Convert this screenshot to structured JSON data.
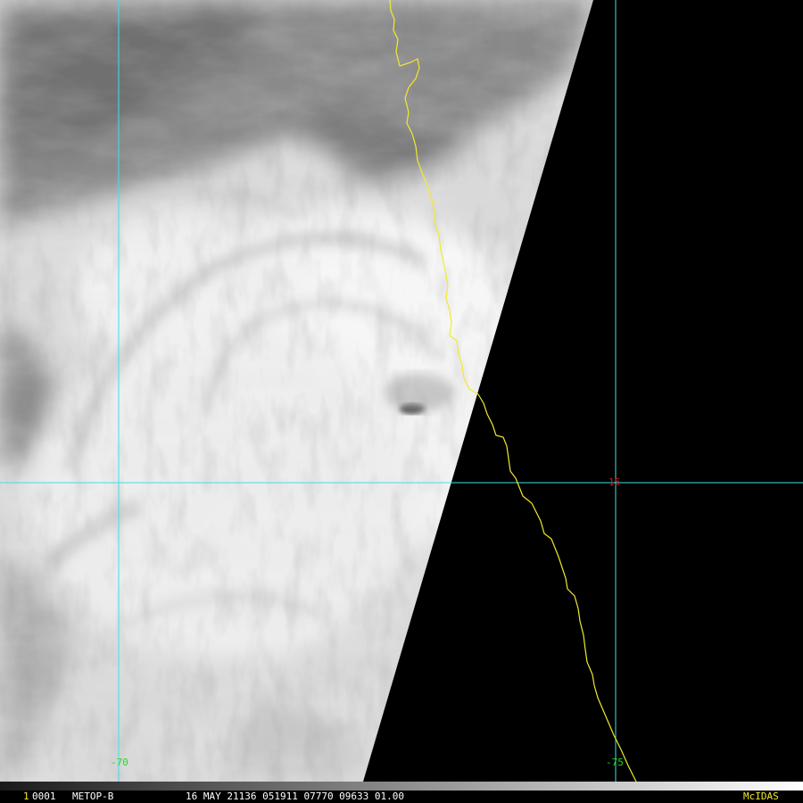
{
  "image": {
    "satellite": "METOP-B",
    "colors": {
      "grid_lines": "#3fe0e8",
      "coastline": "#f2ea2a",
      "longitude_labels": "#22dd22",
      "latitude_label": "#c82020",
      "no_data": "#000000"
    }
  },
  "grid_labels": {
    "lon_left": "-70",
    "lon_right": "-75",
    "lat_mid": "15"
  },
  "status_bar": {
    "frame_marker": "1",
    "frame_id": "0001",
    "satellite": "METOP-B",
    "datetime_fields": "16 MAY 21136 051911 07770 09633 01.00",
    "software": "McIDAS",
    "colors": {
      "text": "#ffffff",
      "frame_marker": "#f2ea2a",
      "software": "#f2ea2a",
      "scale_start": "#202020",
      "scale_end": "#ffffff"
    }
  }
}
